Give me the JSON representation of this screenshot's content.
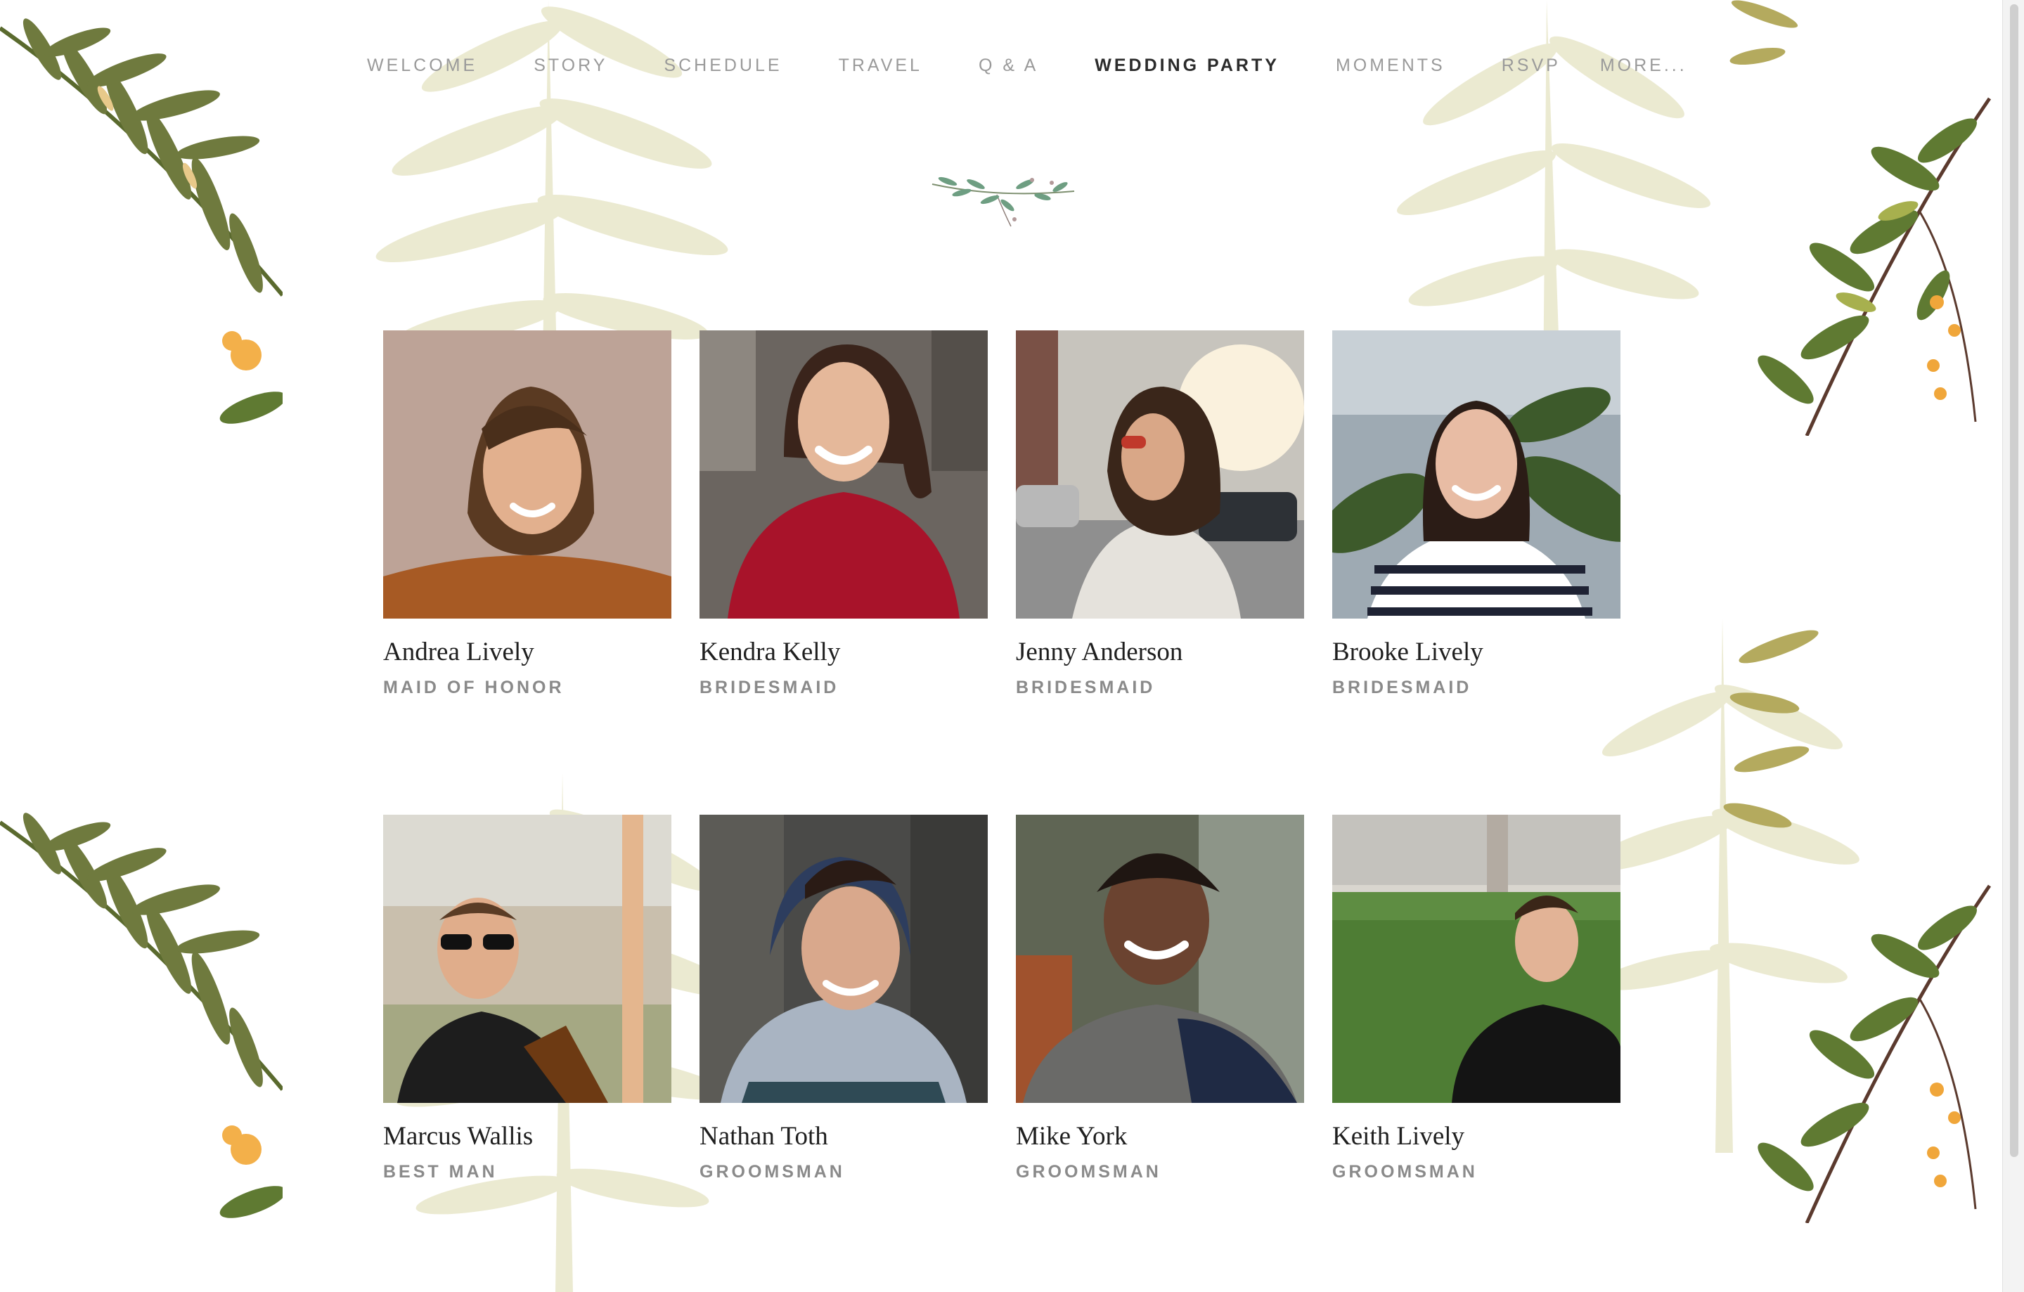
{
  "nav": {
    "items": [
      {
        "label": "WELCOME",
        "active": false
      },
      {
        "label": "STORY",
        "active": false
      },
      {
        "label": "SCHEDULE",
        "active": false
      },
      {
        "label": "TRAVEL",
        "active": false
      },
      {
        "label": "Q & A",
        "active": false
      },
      {
        "label": "WEDDING PARTY",
        "active": true
      },
      {
        "label": "MOMENTS",
        "active": false
      },
      {
        "label": "RSVP",
        "active": false
      },
      {
        "label": "MORE...",
        "active": false
      }
    ]
  },
  "ornament": {
    "icon": "leaf-sprig-icon"
  },
  "party": [
    {
      "name": "Andrea Lively",
      "role": "MAID OF HONOR",
      "photo": "woman-smiling-bangs-photo"
    },
    {
      "name": "Kendra Kelly",
      "role": "BRIDESMAID",
      "photo": "woman-red-sweater-photo"
    },
    {
      "name": "Jenny Anderson",
      "role": "BRIDESMAID",
      "photo": "woman-sunglasses-street-photo"
    },
    {
      "name": "Brooke Lively",
      "role": "BRIDESMAID",
      "photo": "woman-greenhouse-photo"
    },
    {
      "name": "Marcus Wallis",
      "role": "BEST MAN",
      "photo": "man-sunglasses-bottle-photo"
    },
    {
      "name": "Nathan Toth",
      "role": "GROOMSMAN",
      "photo": "man-beanie-hoodie-photo"
    },
    {
      "name": "Mike York",
      "role": "GROOMSMAN",
      "photo": "man-curly-hair-photo"
    },
    {
      "name": "Keith Lively",
      "role": "GROOMSMAN",
      "photo": "man-park-lawn-photo"
    }
  ],
  "colors": {
    "nav_text": "#9a9a9a",
    "nav_active": "#2b2b2b",
    "role_text": "#8a8a8a",
    "fern_dark": "#6f7a3e",
    "fern_pale": "#e5e2c2"
  }
}
